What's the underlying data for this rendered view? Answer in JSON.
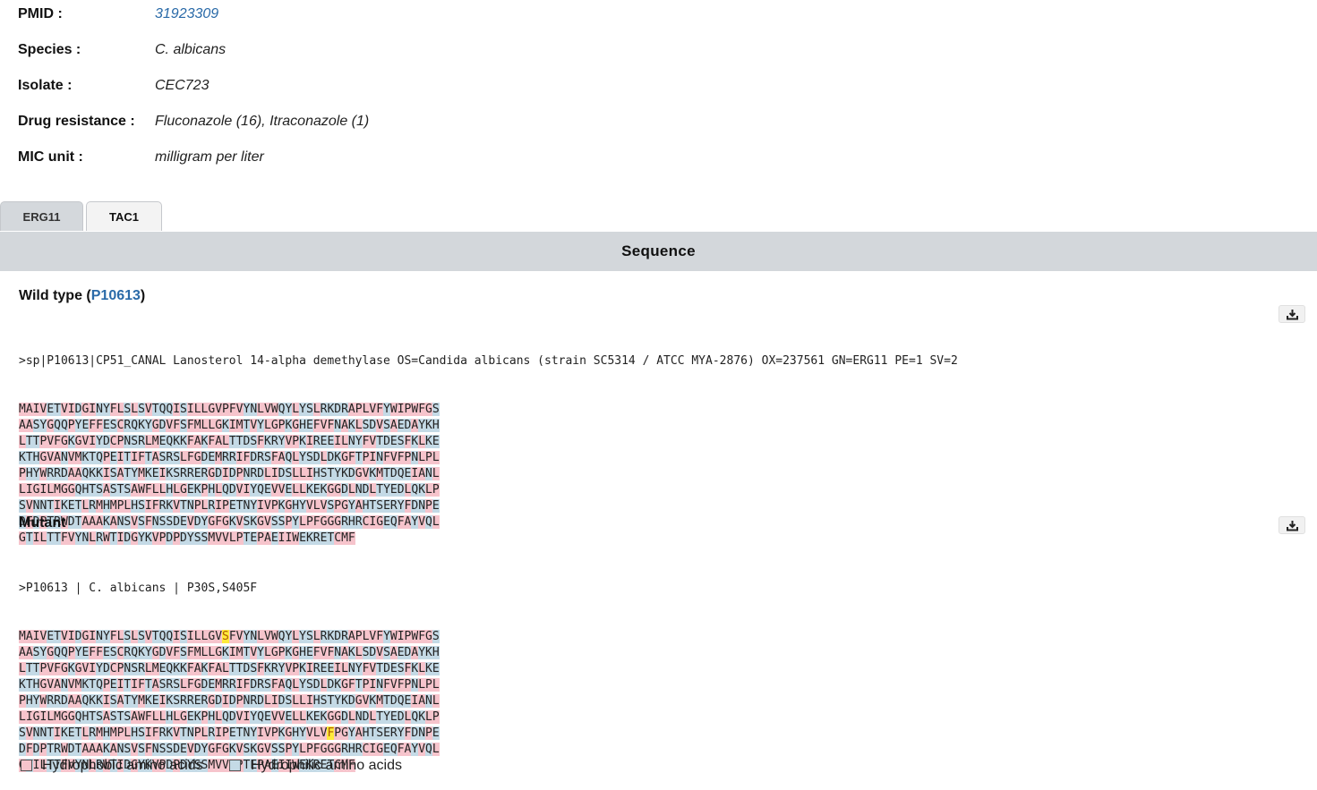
{
  "info": {
    "pmid_label": "PMID :",
    "pmid_value": "31923309",
    "species_label": "Species :",
    "species_value": "C. albicans",
    "isolate_label": "Isolate :",
    "isolate_value": "CEC723",
    "drug_label": "Drug resistance :",
    "drug_value": "Fluconazole (16), Itraconazole (1)",
    "mic_label": "MIC unit :",
    "mic_value": "milligram per liter"
  },
  "tabs": [
    {
      "label": "ERG11",
      "active": false
    },
    {
      "label": "TAC1",
      "active": true
    }
  ],
  "sequence_header": "Sequence",
  "wild_type": {
    "title_prefix": "Wild type (",
    "accession": "P10613",
    "title_suffix": ")",
    "fasta_header": ">sp|P10613|CP51_CANAL Lanosterol 14-alpha demethylase OS=Candida albicans (strain SC5314 / ATCC MYA-2876) OX=237561 GN=ERG11 PE=1 SV=2",
    "lines": [
      "MAIVETVIDGINYFLSLSVTQQISILLGVPFVYNLVWQYLYSLRKDRAPLVFYWIPWFGS",
      "AASYGQQPYEFFESCRQKYGDVFSFMLLGKIMTVYLGPKGHEFVFNAKLSDVSAEDAYKH",
      "LTTPVFGKGVIYDCPNSRLMEQKKFAKFALTTDSFKRYVPKIREEILNYFVTDESFKLKE",
      "KTHGVANVMKTQPEITIFTASRSLFGDEMRRIFDRSFAQLYSDLDKGFTPINFVFPNLPL",
      "PHYWRRDAAQKKISATYMKEIKSRRERGDIDPNRDLIDSLLIHSTYKDGVKMTDQEIANL",
      "LIGILMGGQHTSASTSAWFLLHLGEKPHLQDVIYQEVVELLKEKGGDLNDLTYEDLQKLP",
      "SVNNTIKETLRMHMPLHSIFRKVTNPLRIPETNYIVPKGHYVLVSPGYAHTSERYFDNPE",
      "DFDPTRWDTAAAKANSVSFNSSDEVDYGFGKVSKGVSSPYLPFGGGRHRCIGEQFAYVQL",
      "GTILTTFVYNLRWTIDGYKVPDPDYSSMVVLPTEPAEIIWEKRETCMF"
    ]
  },
  "mutant": {
    "title": "Mutant",
    "fasta_header": ">P10613 | C. albicans | P30S,S405F",
    "lines": [
      "MAIVETVIDGINYFLSLSVTQQISILLGVSFVYNLVWQYLYSLRKDRAPLVFYWIPWFGS",
      "AASYGQQPYEFFESCRQKYGDVFSFMLLGKIMTVYLGPKGHEFVFNAKLSDVSAEDAYKH",
      "LTTPVFGKGVIYDCPNSRLMEQKKFAKFALTTDSFKRYVPKIREEILNYFVTDESFKLKE",
      "KTHGVANVMKTQPEITIFTASRSLFGDEMRRIFDRSFAQLYSDLDKGFTPINFVFPNLPL",
      "PHYWRRDAAQKKISATYMKEIKSRRERGDIDPNRDLIDSLLIHSTYKDGVKMTDQEIANL",
      "LIGILMGGQHTSASTSAWFLLHLGEKPHLQDVIYQEVVELLKEKGGDLNDLTYEDLQKLP",
      "SVNNTIKETLRMHMPLHSIFRKVTNPLRIPETNYIVPKGHYVLVFPGYAHTSERYFDNPE",
      "DFDPTRWDTAAAKANSVSFNSSDEVDYGFGKVSKGVSSPYLPFGGGRHRCIGEQFAYVQL",
      "GTILTTFVYNLRWTIDGYKVPDPDYSSMVVLPTEPAEIIWEKRETCMF"
    ],
    "mutation_positions": [
      30,
      405
    ]
  },
  "hydrophobic_residues": "AVILMFWCPG",
  "legend": {
    "hydrophobic_label": "Hydrophobic amino acids",
    "hydrophilic_label": "Hydrophilic amino acids",
    "hydrophobic_color": "#f6c4cc",
    "hydrophilic_color": "#c4dae6",
    "mutation_color": "#ffeb3b"
  },
  "icons": {
    "download": "download-icon"
  }
}
